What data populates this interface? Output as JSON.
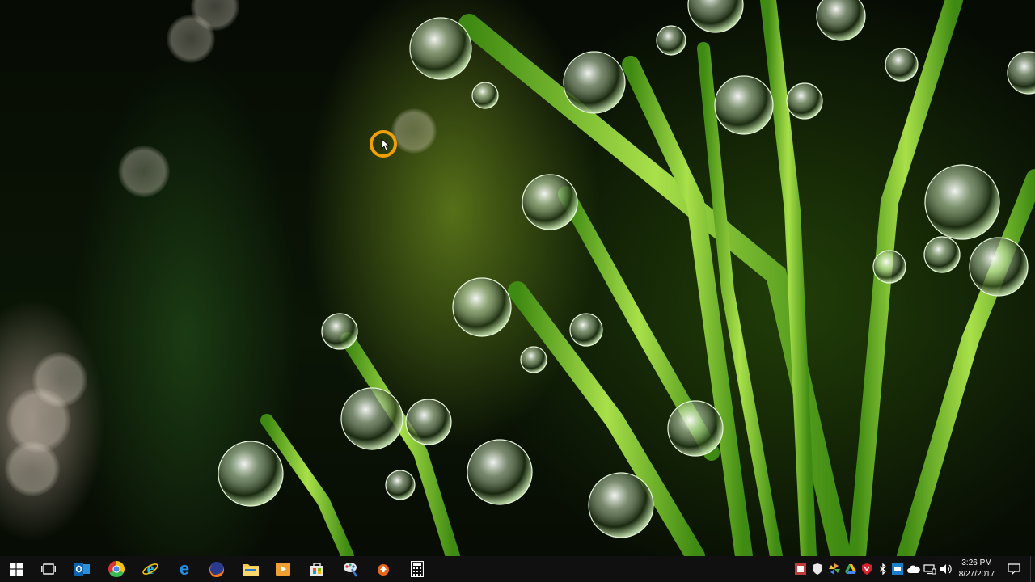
{
  "desktop": {
    "wallpaper": "dew-drops-on-green-plant"
  },
  "taskbar": {
    "background": "#101010",
    "pinned": [
      {
        "name": "start",
        "icon": "windows-logo-icon"
      },
      {
        "name": "task-view",
        "icon": "task-view-icon"
      },
      {
        "name": "outlook",
        "icon": "outlook-icon"
      },
      {
        "name": "chrome",
        "icon": "chrome-icon"
      },
      {
        "name": "internet-explorer",
        "icon": "internet-explorer-icon"
      },
      {
        "name": "edge",
        "icon": "edge-icon"
      },
      {
        "name": "firefox",
        "icon": "firefox-icon"
      },
      {
        "name": "file-explorer",
        "icon": "folder-icon"
      },
      {
        "name": "media",
        "icon": "media-player-icon"
      },
      {
        "name": "store",
        "icon": "store-icon"
      },
      {
        "name": "paint",
        "icon": "paint-icon"
      },
      {
        "name": "app",
        "icon": "orange-app-icon"
      },
      {
        "name": "calculator",
        "icon": "calculator-icon"
      }
    ],
    "tray": {
      "icons": [
        "security-icon",
        "shield-icon",
        "pinwheel-icon",
        "google-drive-icon",
        "antivirus-icon",
        "bluetooth-icon",
        "network-adapter-icon",
        "onedrive-icon",
        "wifi-icon",
        "volume-icon"
      ],
      "time": "3:26 PM",
      "date": "8/27/2017",
      "notification_icon": "notification-icon"
    }
  }
}
